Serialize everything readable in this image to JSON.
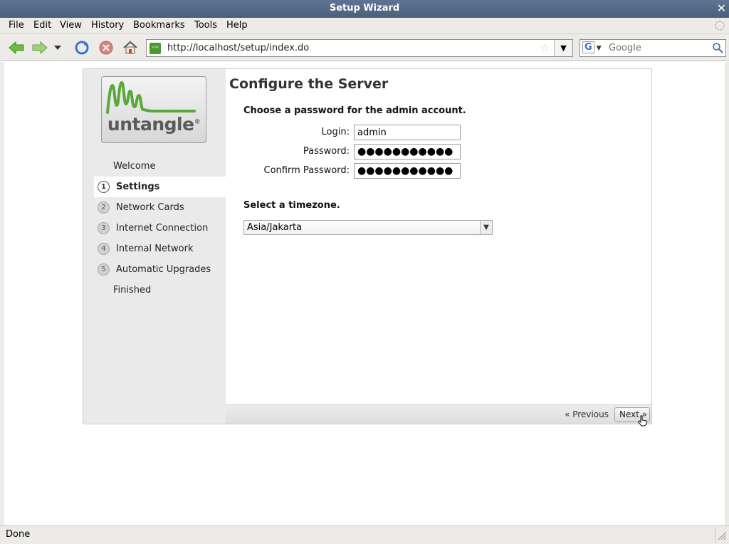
{
  "window": {
    "title": "Setup Wizard",
    "close_glyph": "✕"
  },
  "menu": {
    "items": [
      "File",
      "Edit",
      "View",
      "History",
      "Bookmarks",
      "Tools",
      "Help"
    ]
  },
  "toolbar": {
    "back_icon": "back-arrow-icon",
    "forward_icon": "forward-arrow-icon",
    "history_dropdown_icon": "chevron-down-icon",
    "reload_icon": "reload-icon",
    "stop_icon": "stop-icon",
    "home_icon": "home-icon",
    "url": "http://localhost/setup/index.do",
    "search_placeholder": "Google",
    "search_engine_letter": "G"
  },
  "logo": {
    "text": "untangle",
    "mark": "®"
  },
  "steps": [
    {
      "num": "",
      "label": "Welcome",
      "active": false
    },
    {
      "num": "1",
      "label": "Settings",
      "active": true
    },
    {
      "num": "2",
      "label": "Network Cards",
      "active": false
    },
    {
      "num": "3",
      "label": "Internet Connection",
      "active": false
    },
    {
      "num": "4",
      "label": "Internal Network",
      "active": false
    },
    {
      "num": "5",
      "label": "Automatic Upgrades",
      "active": false
    },
    {
      "num": "",
      "label": "Finished",
      "active": false
    }
  ],
  "page": {
    "title": "Configure the Server",
    "password_heading": "Choose a password for the admin account.",
    "login_label": "Login:",
    "login_value": "admin",
    "password_label": "Password:",
    "password_value": "●●●●●●●●●●●",
    "confirm_label": "Confirm Password:",
    "confirm_value": "●●●●●●●●●●●",
    "timezone_heading": "Select a timezone.",
    "timezone_value": "Asia/Jakarta",
    "previous_label": "« Previous",
    "next_label": "Next »"
  },
  "status": {
    "text": "Done"
  },
  "colors": {
    "accent_green": "#4a9a2a",
    "titlebar": "#4f6583"
  }
}
